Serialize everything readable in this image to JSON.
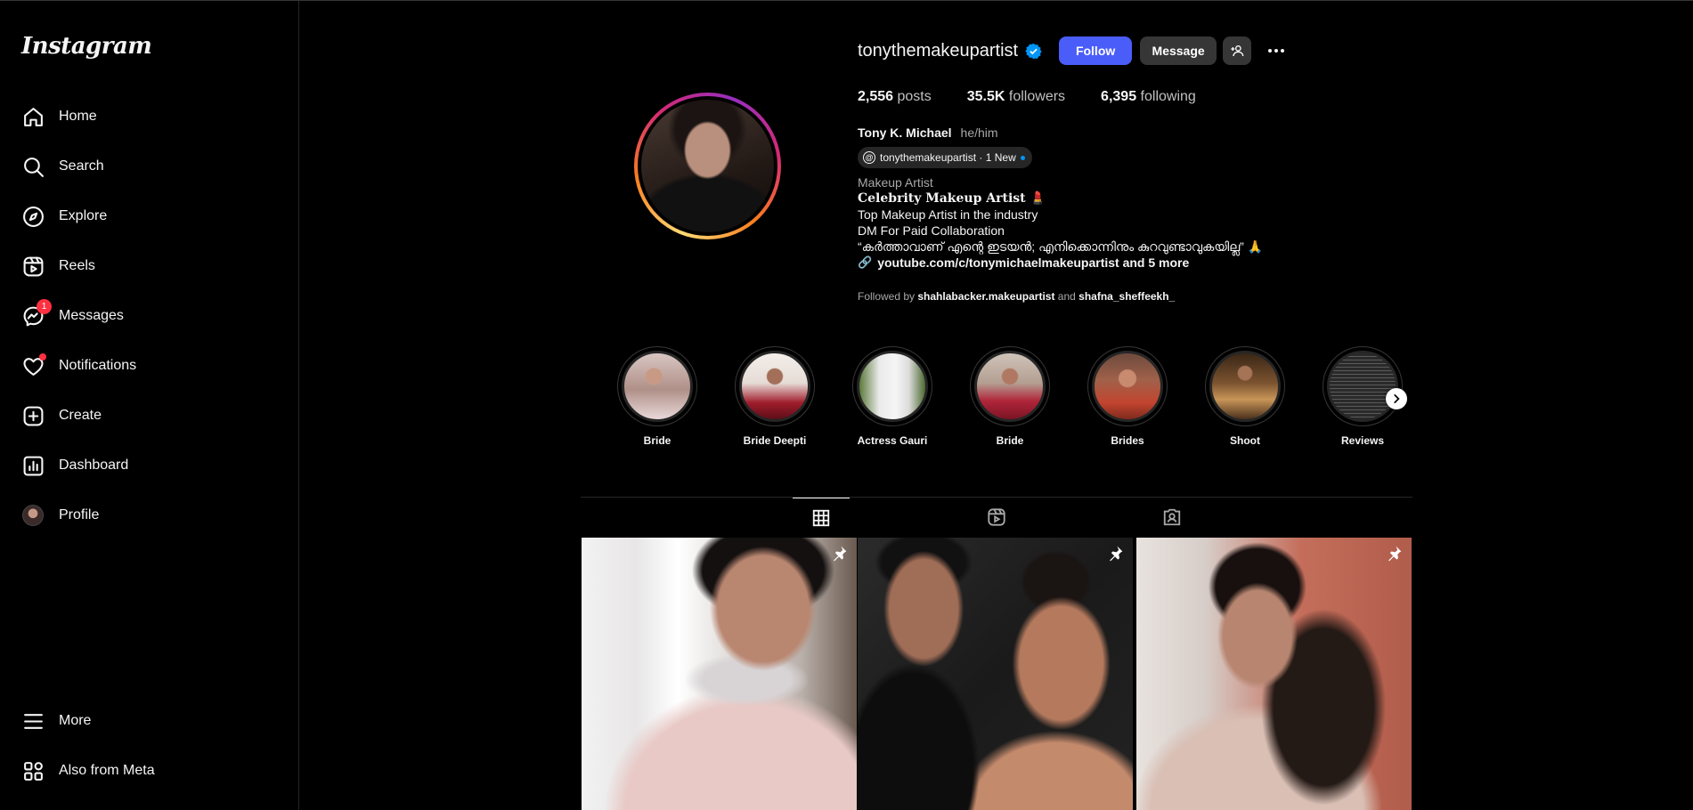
{
  "sidebar": {
    "logo": "Instagram",
    "items": [
      {
        "label": "Home"
      },
      {
        "label": "Search"
      },
      {
        "label": "Explore"
      },
      {
        "label": "Reels"
      },
      {
        "label": "Messages",
        "badge": "1"
      },
      {
        "label": "Notifications"
      },
      {
        "label": "Create"
      },
      {
        "label": "Dashboard"
      },
      {
        "label": "Profile"
      }
    ],
    "bottom": [
      {
        "label": "More"
      },
      {
        "label": "Also from Meta"
      }
    ]
  },
  "profile": {
    "username": "tonythemakeupartist",
    "follow_label": "Follow",
    "message_label": "Message",
    "stats": {
      "posts_count": "2,556",
      "posts_label": "posts",
      "followers_count": "35.5K",
      "followers_label": "followers",
      "following_count": "6,395",
      "following_label": "following"
    },
    "full_name": "Tony K. Michael",
    "pronouns": "he/him",
    "threads_chip": "tonythemakeupartist · 1 New",
    "category": "Makeup Artist",
    "bio_lines": [
      "Celebrity Makeup Artist 💄",
      "Top Makeup Artist in the industry",
      "DM For Paid Collaboration",
      "“കർത്താവാണ് എന്റെ ഇടയൻ; എനിക്കൊന്നിനും കുറവുണ്ടാവുകയില്ല” 🙏"
    ],
    "link_text": "youtube.com/c/tonymichaelmakeupartist and 5 more",
    "followed_by_prefix": "Followed by",
    "followed_by_user1": "shahlabacker.makeupartist",
    "followed_by_and": "and",
    "followed_by_user2": "shafna_sheffeekh_"
  },
  "highlights": [
    {
      "label": "Bride"
    },
    {
      "label": "Bride Deepti"
    },
    {
      "label": "Actress Gauri"
    },
    {
      "label": "Bride"
    },
    {
      "label": "Brides"
    },
    {
      "label": "Shoot"
    },
    {
      "label": "Reviews"
    }
  ],
  "tabs": [
    {
      "icon": "grid-icon",
      "active": true
    },
    {
      "icon": "reels-icon",
      "active": false
    },
    {
      "icon": "tagged-icon",
      "active": false
    }
  ],
  "colors": {
    "background": "#000000",
    "follow_button": "#4a5df9",
    "secondary_button": "#363636",
    "notification_red": "#ff3040",
    "verified_blue": "#0095f6"
  }
}
